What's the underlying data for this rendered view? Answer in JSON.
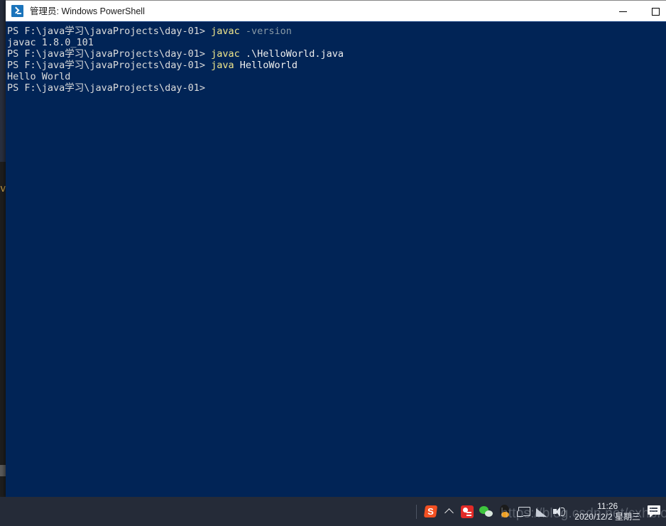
{
  "window": {
    "title": "管理员: Windows PowerShell",
    "icon": "powershell-icon",
    "controls": {
      "minimize_label": "—",
      "maximize_label": "□"
    },
    "background_color": "#012456"
  },
  "terminal": {
    "prompt": "PS F:\\java学习\\javaProjects\\day-01>",
    "lines": [
      {
        "id": "line-1",
        "segments": [
          {
            "text": "PS F:\\java学习\\javaProjects\\day-01> ",
            "style": "default"
          },
          {
            "text": "javac ",
            "style": "yellow"
          },
          {
            "text": "-version",
            "style": "gray"
          }
        ]
      },
      {
        "id": "line-2",
        "segments": [
          {
            "text": "javac 1.8.0_101",
            "style": "default"
          }
        ]
      },
      {
        "id": "line-3",
        "segments": [
          {
            "text": "PS F:\\java学习\\javaProjects\\day-01> ",
            "style": "default"
          },
          {
            "text": "javac ",
            "style": "yellow"
          },
          {
            "text": ".\\HelloWorld.java",
            "style": "white"
          }
        ]
      },
      {
        "id": "line-4",
        "segments": [
          {
            "text": "PS F:\\java学习\\javaProjects\\day-01> ",
            "style": "default"
          },
          {
            "text": "java ",
            "style": "yellow"
          },
          {
            "text": "HelloWorld",
            "style": "white"
          }
        ]
      },
      {
        "id": "line-5",
        "segments": [
          {
            "text": "Hello World",
            "style": "default"
          }
        ]
      },
      {
        "id": "line-6",
        "segments": [
          {
            "text": "PS F:\\java学习\\javaProjects\\day-01>",
            "style": "default"
          }
        ]
      }
    ]
  },
  "background_window": {
    "visible_text": "v"
  },
  "taskbar": {
    "tray_icons": [
      {
        "name": "sogou-input-icon",
        "label": "S"
      },
      {
        "name": "show-hidden-icons-chevron-icon",
        "label": "^"
      },
      {
        "name": "youdao-dictionary-icon",
        "label": ""
      },
      {
        "name": "wechat-icon",
        "label": ""
      },
      {
        "name": "qq-icon",
        "label": ""
      },
      {
        "name": "display-settings-icon",
        "label": ""
      },
      {
        "name": "network-icon",
        "label": ""
      },
      {
        "name": "volume-icon",
        "label": ""
      }
    ],
    "clock": {
      "time": "11:26",
      "date": "2020/12/2 星期三"
    },
    "action_center": "action-center-icon"
  },
  "watermark": {
    "text": "https://blog.csdn.net/cxhblog"
  }
}
